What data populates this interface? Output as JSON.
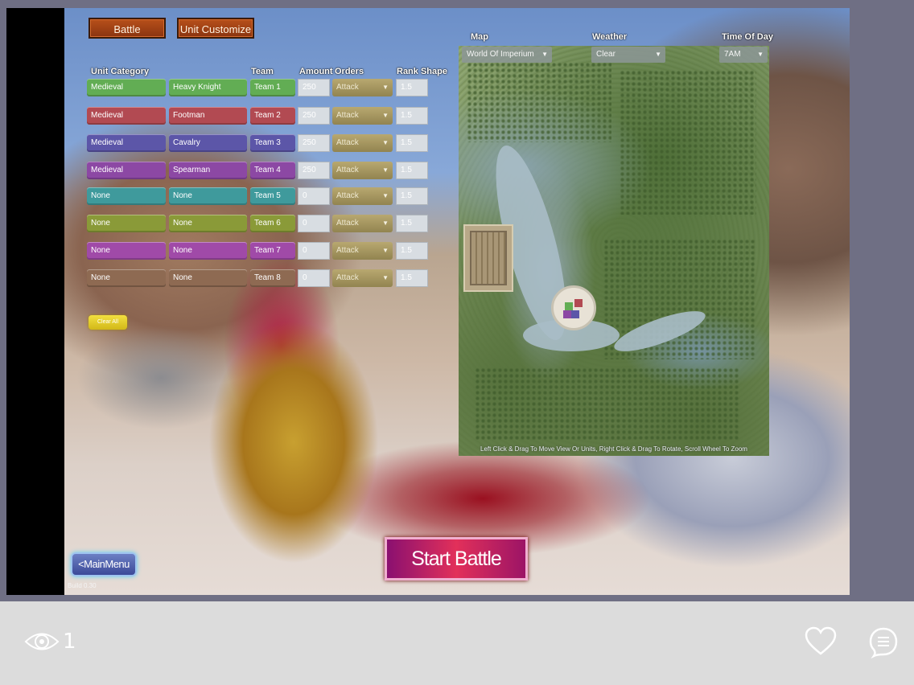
{
  "top_buttons": {
    "battle": "Battle",
    "unit_customize": "Unit Customize"
  },
  "table": {
    "headers": {
      "unit_category": "Unit Category",
      "team": "Team",
      "amount": "Amount",
      "orders": "Orders",
      "rank_shape": "Rank Shape"
    },
    "rows": [
      {
        "category": "Medieval",
        "unit": "Heavy Knight",
        "team": "Team 1",
        "amount": "250",
        "orders": "Attack",
        "rank_shape": "1.5",
        "color": "#62ad54"
      },
      {
        "category": "Medieval",
        "unit": "Footman",
        "team": "Team 2",
        "amount": "250",
        "orders": "Attack",
        "rank_shape": "1.5",
        "color": "#b24a52"
      },
      {
        "category": "Medieval",
        "unit": "Cavalry",
        "team": "Team 3",
        "amount": "250",
        "orders": "Attack",
        "rank_shape": "1.5",
        "color": "#5c56a8"
      },
      {
        "category": "Medieval",
        "unit": "Spearman",
        "team": "Team 4",
        "amount": "250",
        "orders": "Attack",
        "rank_shape": "1.5",
        "color": "#8c48a4"
      },
      {
        "category": "None",
        "unit": "None",
        "team": "Team 5",
        "amount": "0",
        "orders": "Attack",
        "rank_shape": "1.5",
        "color": "#3f9a9c"
      },
      {
        "category": "None",
        "unit": "None",
        "team": "Team 6",
        "amount": "0",
        "orders": "Attack",
        "rank_shape": "1.5",
        "color": "#8a9a38"
      },
      {
        "category": "None",
        "unit": "None",
        "team": "Team 7",
        "amount": "0",
        "orders": "Attack",
        "rank_shape": "1.5",
        "color": "#a04aa8"
      },
      {
        "category": "None",
        "unit": "None",
        "team": "Team 8",
        "amount": "0",
        "orders": "Attack",
        "rank_shape": "1.5",
        "color": "#8e6a52"
      }
    ]
  },
  "settings": {
    "map": {
      "label": "Map",
      "value": "World Of Imperium"
    },
    "weather": {
      "label": "Weather",
      "value": "Clear"
    },
    "time_of_day": {
      "label": "Time Of Day",
      "value": "7AM"
    }
  },
  "map_hint": "Left Click & Drag To Move View Or Units, Right Click & Drag To Rotate, Scroll Wheel To Zoom",
  "clear_all": "Clear All",
  "main_menu": "<MainMenu",
  "build": "Build 0.30",
  "start_battle": "Start Battle",
  "bottom_bar": {
    "views_count": "1"
  }
}
